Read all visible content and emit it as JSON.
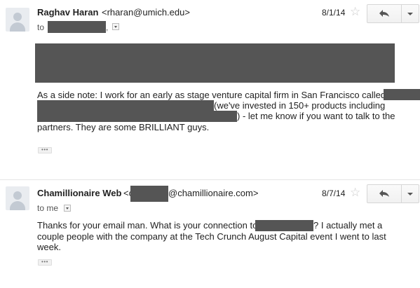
{
  "messages": [
    {
      "sender_name": "Raghav Haran",
      "sender_email": "<rharan@umich.edu>",
      "date": "8/1/14",
      "recipient_prefix": "to",
      "recipient_suffix": ",",
      "body_line1": "As a side note: I work for an early as stage venture capital firm in San Francisco called",
      "body_line2": "(we've invested in 150+ products including",
      "body_line3": ") - let me know if you want to talk to the",
      "body_line4": "partners. They are some BRILLIANT guys.",
      "ellipsis": "•••"
    },
    {
      "sender_name": "Chamillionaire Web",
      "sender_email_open": "<c",
      "sender_email_rest": "@chamillionaire.com>",
      "date": "8/7/14",
      "recipient": "to me",
      "body_line1a": "Thanks for your email man. What is your connection to",
      "body_line1b": "? I actually met a",
      "body_line2": "couple people with the company at the Tech Crunch August Capital event I went to last",
      "body_line3": "week.",
      "ellipsis": "•••"
    }
  ],
  "icons": {
    "star": "☆",
    "reply": "reply-arrow",
    "more": "chevron-down"
  }
}
